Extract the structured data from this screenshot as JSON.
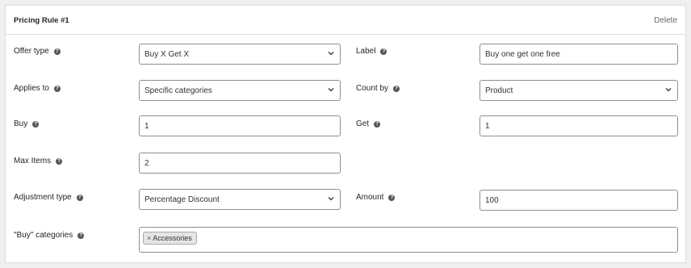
{
  "rule": {
    "title": "Pricing Rule #1",
    "delete_label": "Delete"
  },
  "fields": {
    "offer_type": {
      "label": "Offer type",
      "value": "Buy X Get X"
    },
    "label": {
      "label": "Label",
      "value": "Buy one get one free"
    },
    "applies_to": {
      "label": "Applies to",
      "value": "Specific categories"
    },
    "count_by": {
      "label": "Count by",
      "value": "Product"
    },
    "buy": {
      "label": "Buy",
      "value": "1"
    },
    "get": {
      "label": "Get",
      "value": "1"
    },
    "max_items": {
      "label": "Max Items",
      "value": "2"
    },
    "adjustment_type": {
      "label": "Adjustment type",
      "value": "Percentage Discount"
    },
    "amount": {
      "label": "Amount",
      "value": "100"
    },
    "buy_categories": {
      "label": "\"Buy\" categories",
      "tags": [
        "Accessories"
      ]
    }
  },
  "icons": {
    "help": "question-circle-icon",
    "dropdown": "chevron-down-icon",
    "remove_tag": "close-icon"
  },
  "colors": {
    "background": "#f0f0f1",
    "panel": "#ffffff",
    "border": "#8c8f94",
    "muted_text": "#646970"
  }
}
